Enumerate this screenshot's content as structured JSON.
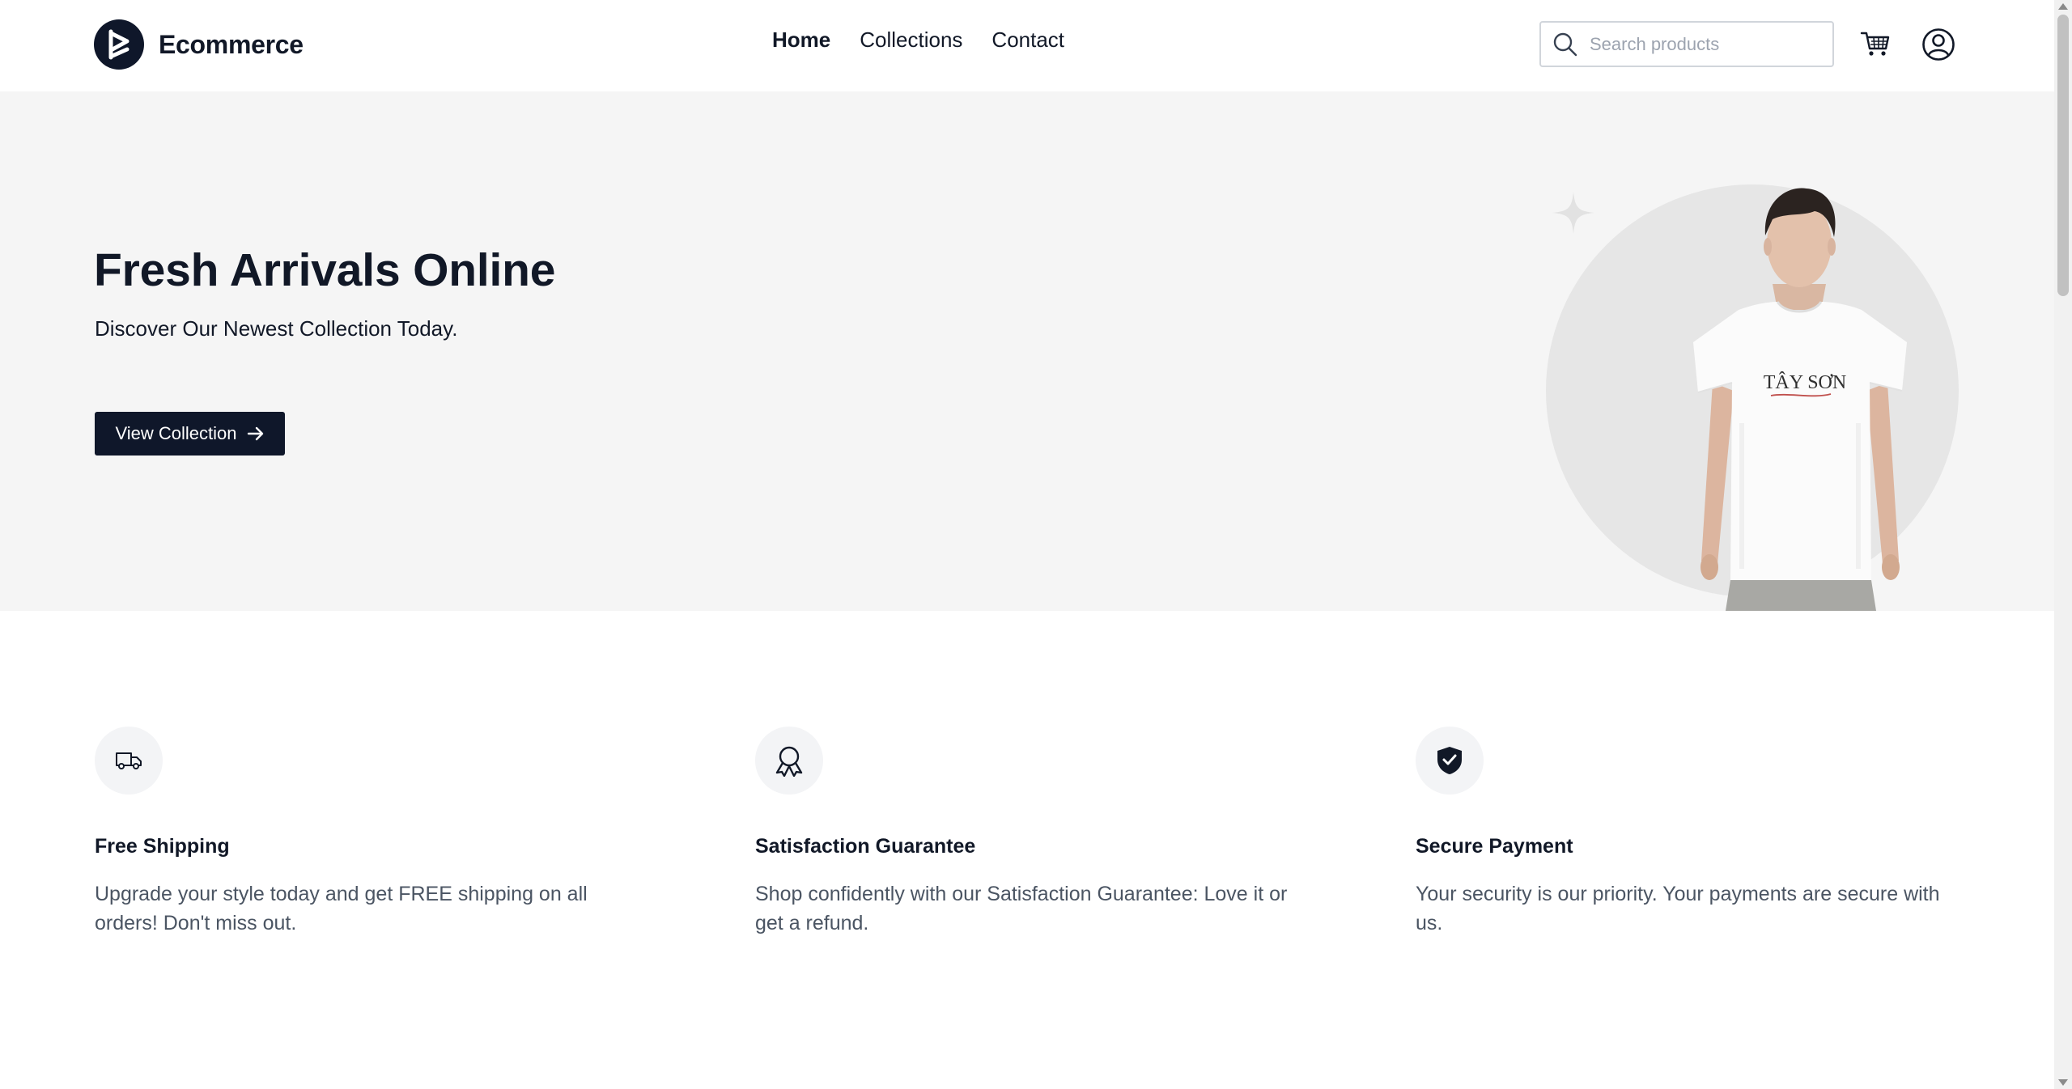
{
  "brand": {
    "name": "Ecommerce",
    "logo_icon": "brand-logo-icon"
  },
  "nav": {
    "items": [
      {
        "label": "Home",
        "active": true
      },
      {
        "label": "Collections",
        "active": false
      },
      {
        "label": "Contact",
        "active": false
      }
    ]
  },
  "search": {
    "placeholder": "Search products",
    "value": "",
    "icon": "search-icon"
  },
  "header_actions": {
    "cart_icon": "cart-icon",
    "account_icon": "user-circle-icon"
  },
  "hero": {
    "title": "Fresh Arrivals Online",
    "subtitle": "Discover Our Newest Collection Today.",
    "cta_label": "View Collection",
    "cta_icon": "arrow-right-icon",
    "shirt_print": "TÂY SƠN"
  },
  "features": [
    {
      "icon": "truck-icon",
      "title": "Free Shipping",
      "description": "Upgrade your style today and get FREE shipping on all orders! Don't miss out."
    },
    {
      "icon": "award-ribbon-icon",
      "title": "Satisfaction Guarantee",
      "description": "Shop confidently with our Satisfaction Guarantee: Love it or get a refund."
    },
    {
      "icon": "shield-check-icon",
      "title": "Secure Payment",
      "description": "Your security is our priority. Your payments are secure with us."
    }
  ],
  "colors": {
    "primary": "#0f172a",
    "hero_bg": "#f5f5f5",
    "text": "#111827",
    "muted": "#4b5563"
  }
}
